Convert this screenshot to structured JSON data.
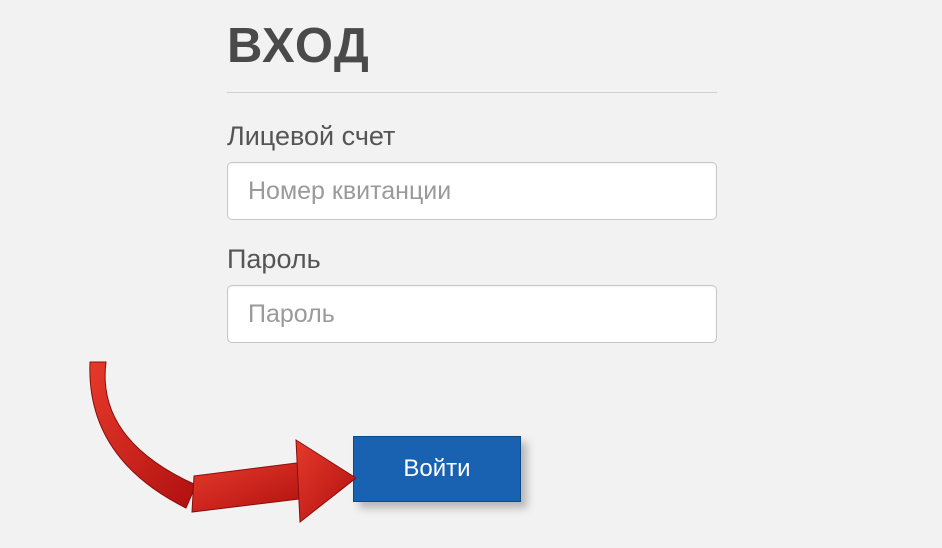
{
  "login": {
    "title": "ВХОД",
    "account": {
      "label": "Лицевой счет",
      "placeholder": "Номер квитанции",
      "value": ""
    },
    "password": {
      "label": "Пароль",
      "placeholder": "Пароль",
      "value": ""
    },
    "submit_label": "Войти"
  },
  "annotation": {
    "arrow": "red-arrow-pointer"
  },
  "colors": {
    "button_bg": "#1862b1",
    "arrow_fill": "#d61f1f"
  }
}
